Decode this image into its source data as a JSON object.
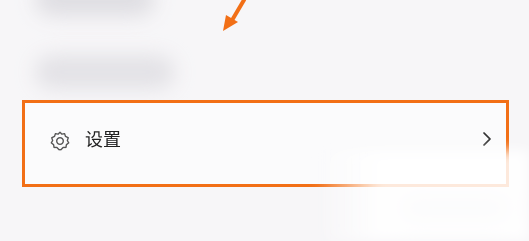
{
  "settings": {
    "label": "设置",
    "icon": "gear-icon",
    "chevron_icon": "chevron-right-icon"
  },
  "annotation": {
    "color": "#f26f16"
  }
}
